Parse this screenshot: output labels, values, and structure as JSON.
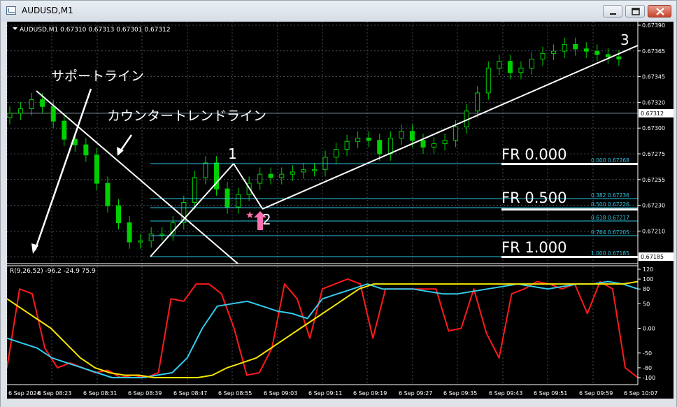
{
  "window": {
    "title": "AUDUSD,M1"
  },
  "main_header": "AUDUSD,M1  0.67310 0.67313 0.67301 0.67312",
  "indicator_header": "R(9,26,52) -96.2 -24.9 75.9",
  "price_axis": {
    "ticks": [
      "0.67390",
      "0.67365",
      "0.67345",
      "0.67320",
      "0.67300",
      "0.67275",
      "0.67255",
      "0.67230",
      "0.67210",
      "0.67185"
    ],
    "current_price": "0.67312",
    "bottom_marker": "0.67185"
  },
  "indicator_axis": {
    "ticks": [
      "120",
      "100",
      "80",
      "50",
      "0.00",
      "-50",
      "-80",
      "-100"
    ]
  },
  "time_axis": {
    "ticks": [
      "6 Sep 2024",
      "6 Sep 08:23",
      "6 Sep 08:31",
      "6 Sep 08:39",
      "6 Sep 08:47",
      "6 Sep 08:55",
      "6 Sep 09:03",
      "6 Sep 09:11",
      "6 Sep 09:19",
      "6 Sep 09:27",
      "6 Sep 09:35",
      "6 Sep 09:43",
      "6 Sep 09:51",
      "6 Sep 09:59",
      "6 Sep 10:07"
    ]
  },
  "annotations": {
    "support_line": "サポートライン",
    "counter_trend_line": "カウンタートレンドライン",
    "wave1": "1",
    "wave2": "2",
    "wave3": "3"
  },
  "fibonacci": {
    "levels": [
      {
        "label": "0.000  0.67268"
      },
      {
        "label": "0.382  0.67236"
      },
      {
        "label": "0.500  0.67226"
      },
      {
        "label": "0.618  0.67217"
      },
      {
        "label": "0.764  0.67205"
      },
      {
        "label": "1.000  0.67185"
      }
    ],
    "big_labels": [
      "FR 0.000",
      "FR 0.500",
      "FR 1.000"
    ]
  },
  "colors": {
    "candle": "#00d000",
    "fib": "#2ec4e0",
    "indicator_red": "#ff1a1a",
    "indicator_cyan": "#33ccee",
    "indicator_yellow": "#f5e600",
    "arrow": "#ff70b0",
    "grid": "#6f7f8f"
  },
  "chart_data": {
    "type": "line",
    "price_series": {
      "name": "AUDUSD M1",
      "x": [
        "08:16",
        "08:18",
        "08:20",
        "08:22",
        "08:24",
        "08:26",
        "08:28",
        "08:30",
        "08:32",
        "08:34",
        "08:36",
        "08:38",
        "08:40",
        "08:42",
        "08:44",
        "08:46",
        "08:48",
        "08:50",
        "08:52",
        "08:54",
        "08:56",
        "08:58",
        "09:00",
        "09:02",
        "09:04",
        "09:06",
        "09:08",
        "09:10",
        "09:12",
        "09:14",
        "09:16",
        "09:18",
        "09:20",
        "09:22",
        "09:24",
        "09:26",
        "09:28",
        "09:30",
        "09:32",
        "09:34",
        "09:36",
        "09:38",
        "09:40",
        "09:42",
        "09:44",
        "09:46",
        "09:48",
        "09:50",
        "09:52",
        "09:54",
        "09:56",
        "09:58",
        "10:00",
        "10:02",
        "10:04",
        "10:06",
        "10:08"
      ],
      "close": [
        0.67312,
        0.67316,
        0.67324,
        0.67318,
        0.67305,
        0.67289,
        0.67284,
        0.67275,
        0.6725,
        0.6723,
        0.67215,
        0.67198,
        0.67199,
        0.67205,
        0.67205,
        0.67215,
        0.67233,
        0.67255,
        0.67268,
        0.67245,
        0.67229,
        0.6724,
        0.6725,
        0.67258,
        0.67255,
        0.67258,
        0.6726,
        0.67262,
        0.67262,
        0.67273,
        0.6728,
        0.67287,
        0.6729,
        0.67288,
        0.67276,
        0.6729,
        0.67296,
        0.67288,
        0.67282,
        0.67285,
        0.67288,
        0.673,
        0.67314,
        0.6733,
        0.67352,
        0.67358,
        0.67348,
        0.67352,
        0.6736,
        0.67365,
        0.67367,
        0.67373,
        0.67369,
        0.67367,
        0.67364,
        0.67362,
        0.6736
      ]
    },
    "indicator_series": [
      {
        "name": "R(9)",
        "values": [
          -80,
          80,
          70,
          -40,
          -80,
          -70,
          -80,
          -90,
          -85,
          -100,
          -95,
          -100,
          -90,
          60,
          55,
          90,
          90,
          70,
          0,
          -95,
          -90,
          -40,
          90,
          60,
          -20,
          80,
          90,
          100,
          90,
          -20,
          80,
          80,
          80,
          80,
          80,
          -5,
          0,
          80,
          -10,
          -60,
          70,
          80,
          95,
          90,
          80,
          90,
          30,
          95,
          80,
          -80,
          -100
        ]
      },
      {
        "name": "R(26)",
        "values": [
          -20,
          -30,
          -40,
          -60,
          -70,
          -80,
          -90,
          -100,
          -100,
          -100,
          -95,
          -90,
          -60,
          0,
          45,
          50,
          55,
          45,
          35,
          30,
          20,
          60,
          70,
          80,
          90,
          80,
          80,
          80,
          75,
          70,
          70,
          75,
          80,
          85,
          90,
          85,
          80,
          85,
          90,
          90,
          95,
          90,
          80
        ]
      },
      {
        "name": "R(52)",
        "values": [
          60,
          40,
          20,
          0,
          -30,
          -60,
          -80,
          -90,
          -95,
          -95,
          -100,
          -100,
          -100,
          -100,
          -95,
          -80,
          -70,
          -60,
          -40,
          -20,
          0,
          20,
          40,
          60,
          80,
          90,
          90,
          90,
          90,
          90,
          90,
          90,
          90,
          90,
          90,
          90,
          90,
          90,
          90,
          90,
          90,
          90,
          90,
          95
        ]
      }
    ],
    "ylim_price": [
      0.67185,
      0.6739
    ],
    "ylim_indicator": [
      -100,
      120
    ],
    "grid": true
  }
}
